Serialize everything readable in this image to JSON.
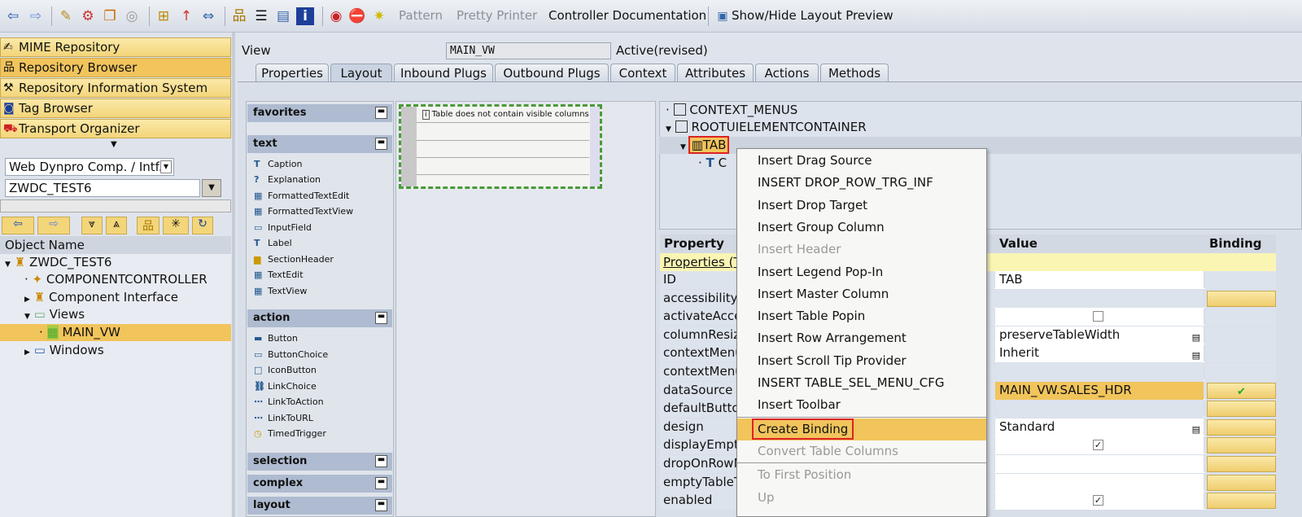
{
  "toolbar": {
    "icons": [
      "back-arrow",
      "forward-arrow",
      "edit-pencil",
      "display-change",
      "activate",
      "where-used",
      "hierarchy",
      "pointer",
      "navigate",
      "object-list",
      "stack",
      "layout",
      "info",
      "debug",
      "stop",
      "wizard"
    ],
    "pattern": "Pattern",
    "pretty_printer": "Pretty Printer",
    "controller_doc": "Controller Documentation",
    "show_hide": "Show/Hide Layout Preview"
  },
  "nav": [
    "MIME Repository",
    "Repository Browser",
    "Repository Information System",
    "Tag Browser",
    "Transport Organizer"
  ],
  "object_type": "Web Dynpro Comp. / Intf.",
  "object_name_value": "ZWDC_TEST6",
  "tree": {
    "header": "Object Name",
    "items": [
      "ZWDC_TEST6",
      "COMPONENTCONTROLLER",
      "Component Interface",
      "Views",
      "MAIN_VW",
      "Windows"
    ]
  },
  "view": {
    "label": "View",
    "name": "MAIN_VW",
    "status": "Active(revised)"
  },
  "tabs": [
    "Properties",
    "Layout",
    "Inbound Plugs",
    "Outbound Plugs",
    "Context",
    "Attributes",
    "Actions",
    "Methods"
  ],
  "palette": {
    "sections": [
      "favorites",
      "text",
      "action",
      "selection",
      "complex",
      "layout"
    ],
    "text_items": [
      "Caption",
      "Explanation",
      "FormattedTextEdit",
      "FormattedTextView",
      "InputField",
      "Label",
      "SectionHeader",
      "TextEdit",
      "TextView"
    ],
    "action_items": [
      "Button",
      "ButtonChoice",
      "IconButton",
      "LinkChoice",
      "LinkToAction",
      "LinkToURL",
      "TimedTrigger"
    ]
  },
  "canvas": {
    "table_message": "Table does not contain visible columns"
  },
  "element_tree": [
    "CONTEXT_MENUS",
    "ROOTUIELEMENTCONTAINER",
    "TAB",
    "C"
  ],
  "properties": {
    "headers": [
      "Property",
      "Value",
      "Binding"
    ],
    "group": "Properties (T",
    "rows": [
      {
        "name": "ID",
        "value": "TAB"
      },
      {
        "name": "accessibilityD",
        "value": ""
      },
      {
        "name": "activateAcces",
        "value": ""
      },
      {
        "name": "columnResiz",
        "value": "preserveTableWidth"
      },
      {
        "name": "contextMenu",
        "value": "Inherit"
      },
      {
        "name": "contextMenu",
        "value": ""
      },
      {
        "name": "dataSource",
        "value": "MAIN_VW.SALES_HDR"
      },
      {
        "name": "defaultButtor",
        "value": ""
      },
      {
        "name": "design",
        "value": "Standard"
      },
      {
        "name": "displayEmpty",
        "value": ""
      },
      {
        "name": "dropOnRowN",
        "value": ""
      },
      {
        "name": "emptyTableT",
        "value": ""
      },
      {
        "name": "enabled",
        "value": ""
      }
    ]
  },
  "context_menu": [
    "Insert Drag Source",
    "INSERT DROP_ROW_TRG_INF",
    "Insert Drop Target",
    "Insert Group Column",
    "Insert Header",
    "Insert Legend Pop-In",
    "Insert Master Column",
    "Insert Table Popin",
    "Insert Row Arrangement",
    "Insert Scroll Tip Provider",
    "INSERT TABLE_SEL_MENU_CFG",
    "Insert Toolbar",
    "Create Binding",
    "Convert Table Columns",
    "To First Position",
    "Up"
  ]
}
